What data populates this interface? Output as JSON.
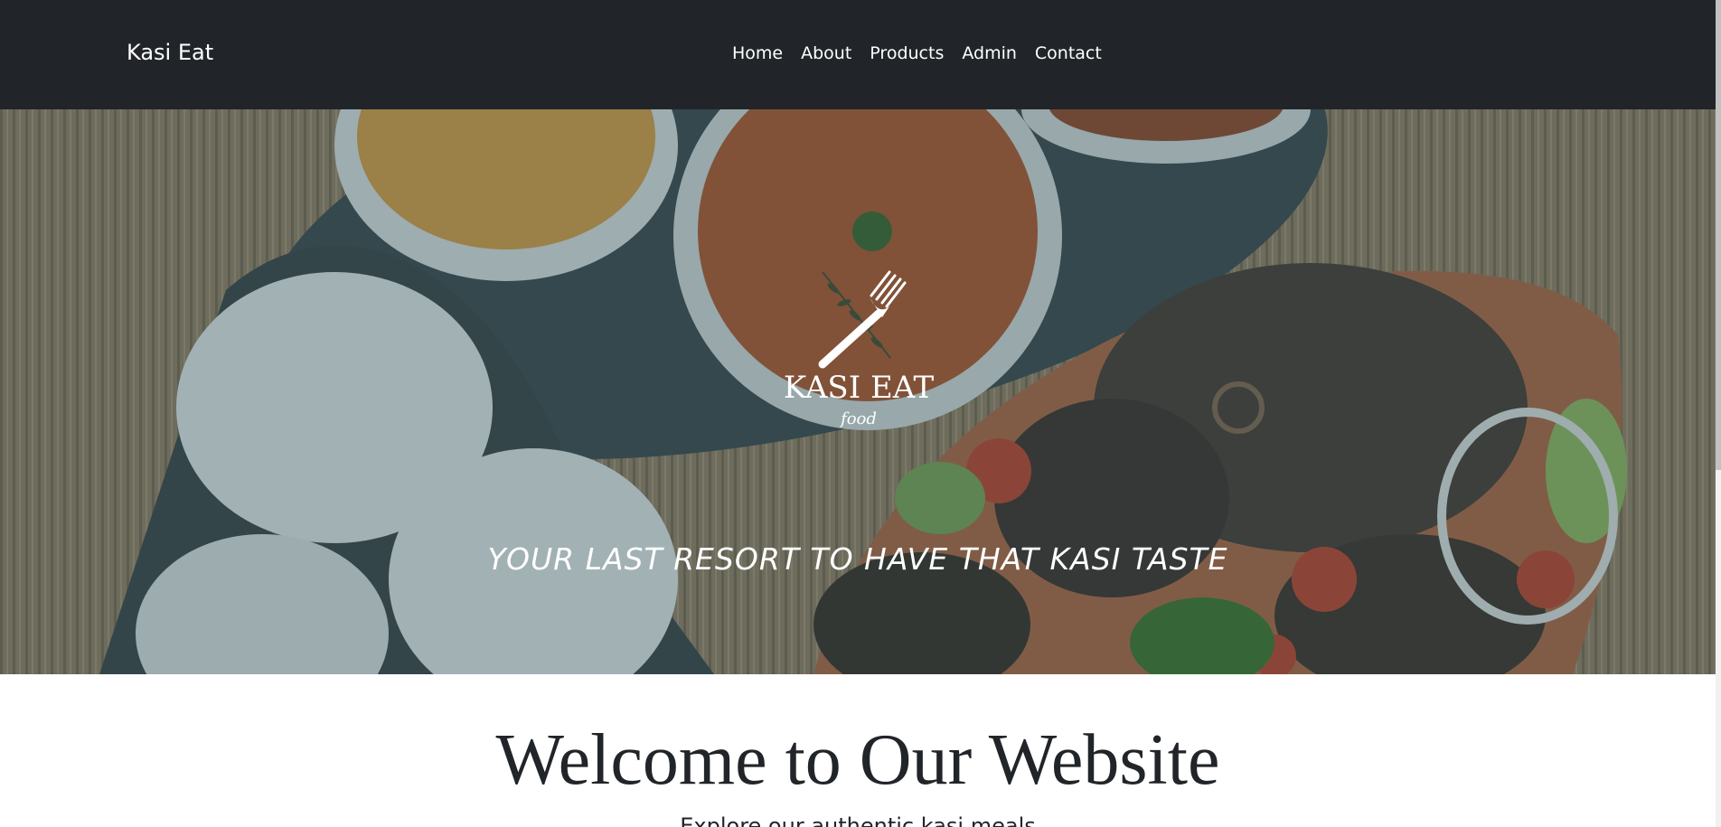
{
  "navbar": {
    "brand": "Kasi Eat",
    "links": [
      "Home",
      "About",
      "Products",
      "Admin",
      "Contact"
    ]
  },
  "hero": {
    "logo_title": "KASI EAT",
    "logo_sub": "food",
    "tagline": "YOUR LAST RESORT TO HAVE THAT KASI TASTE",
    "image_description_icon": "food-platter-image"
  },
  "welcome": {
    "title": "Welcome to Our Website",
    "subtitle": "Explore our authentic kasi meals"
  },
  "colors": {
    "navbar_bg": "#212529",
    "text_light": "#ffffff",
    "text_dark": "#212529"
  }
}
